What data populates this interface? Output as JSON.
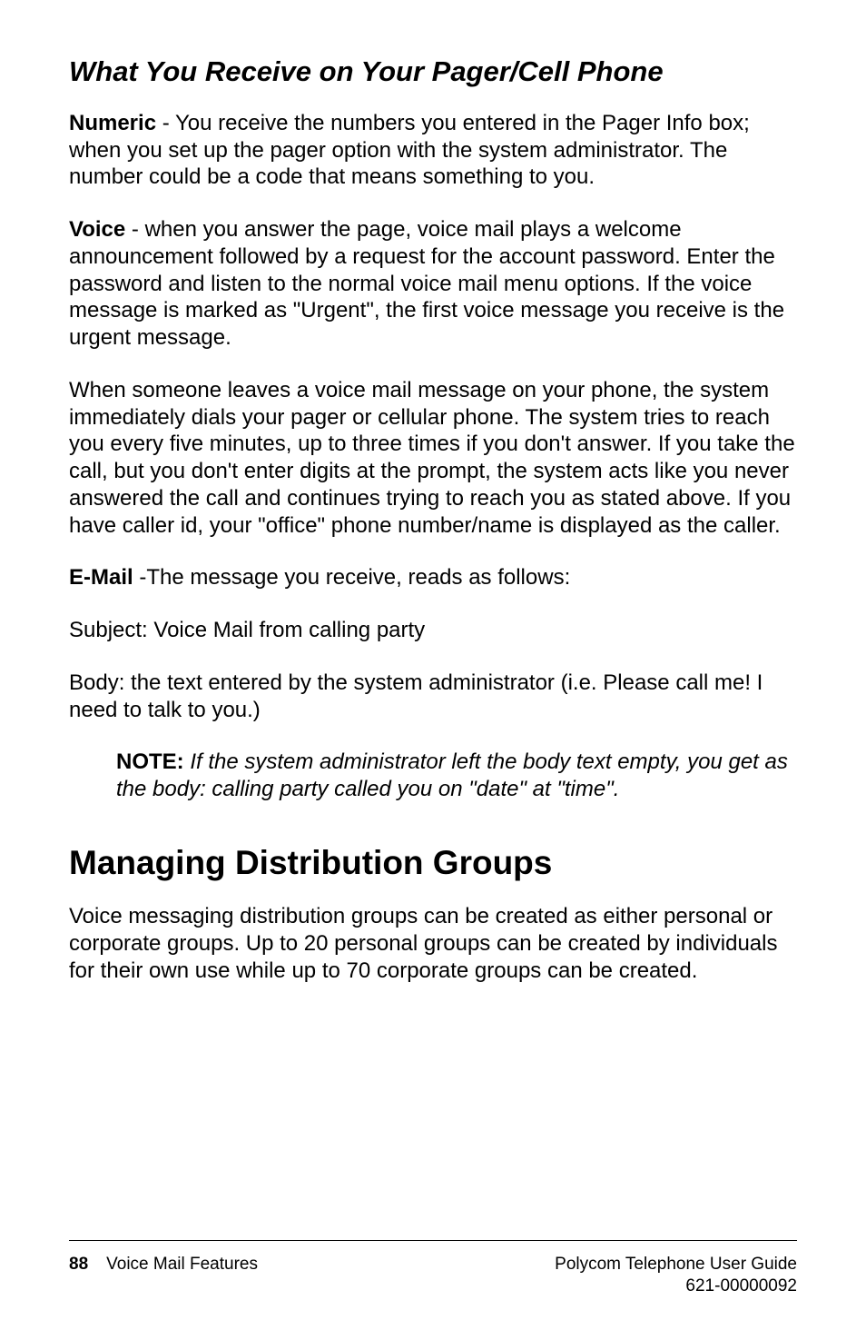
{
  "heading_section": "What You Receive on Your Pager/Cell Phone",
  "para_numeric": {
    "label": "Numeric",
    "text": " - You receive the numbers you entered in the Pager Info box; when you set up the pager option with the system administrator. The number could be a code that means something to you."
  },
  "para_voice": {
    "label": "Voice",
    "text": " - when you answer the page, voice mail plays a welcome announcement followed by a request for the account password. Enter the password and listen to the normal voice mail menu options. If the voice message is marked as \"Urgent\", the first voice message you receive is the urgent message."
  },
  "para_when": "When someone leaves a voice mail message on your phone, the system immediately dials your pager or cellular phone. The system tries to reach you every five minutes, up to three times if you don't answer. If you take the call, but you don't enter digits at the prompt, the system acts like you never answered the call and continues trying to reach you as stated above. If you have caller id, your \"office\" phone number/name is displayed as the caller.",
  "para_email": {
    "label": "E-Mail",
    "text": " -The message you receive, reads as follows:"
  },
  "para_subject": "Subject: Voice Mail from calling party",
  "para_body": "Body: the text entered by the system administrator (i.e. Please call me! I need to talk to you.)",
  "note": {
    "label": "NOTE:",
    "text": " If the system administrator left the body text empty, you get as the body: calling party called you on \"date\" at \"time\"."
  },
  "heading_main": "Managing Distribution Groups",
  "para_groups": "Voice messaging distribution groups can be created as either personal or corporate groups. Up to 20 personal groups can be created by individuals for their own use while up to 70 corporate groups can be created.",
  "footer": {
    "page": "88",
    "section": "Voice Mail Features",
    "guide": "Polycom Telephone User Guide",
    "docnum": "621-00000092"
  }
}
